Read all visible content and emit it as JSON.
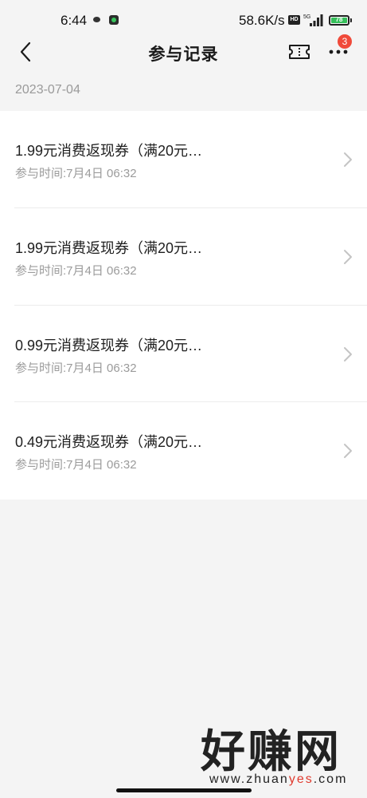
{
  "status_bar": {
    "time": "6:44",
    "network_speed": "58.6K/s",
    "hd_label": "HD",
    "signal_label": "5G",
    "battery_level": "78"
  },
  "nav": {
    "title": "参与记录",
    "badge_count": "3"
  },
  "date_header": "2023-07-04",
  "records": [
    {
      "title": "1.99元消费返现券（满20元…",
      "time": "参与时间:7月4日 06:32"
    },
    {
      "title": "1.99元消费返现券（满20元…",
      "time": "参与时间:7月4日 06:32"
    },
    {
      "title": "0.99元消费返现券（满20元…",
      "time": "参与时间:7月4日 06:32"
    },
    {
      "title": "0.49元消费返现券（满20元…",
      "time": "参与时间:7月4日 06:32"
    }
  ],
  "watermark": {
    "logo_text": "好赚网",
    "url_prefix": "www.zhuan",
    "url_accent": "yes",
    "url_suffix": ".com"
  },
  "colors": {
    "badge": "#f04a3a",
    "battery": "#35c05a",
    "accent": "#e03a2e"
  }
}
